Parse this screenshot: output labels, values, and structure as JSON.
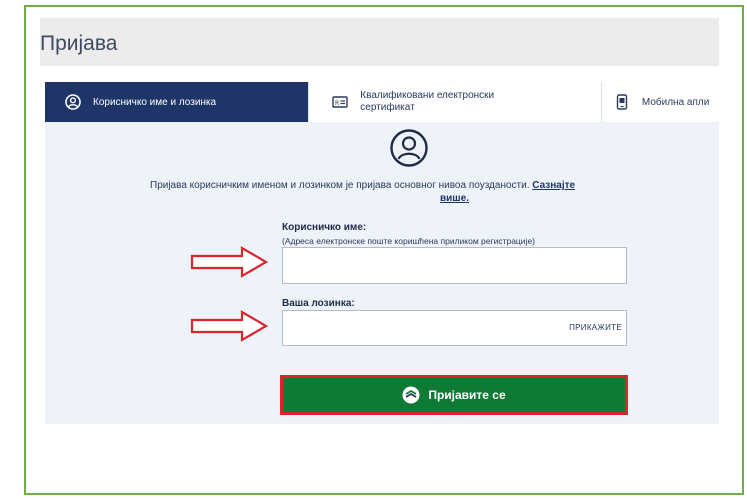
{
  "page": {
    "title": "Пријава"
  },
  "tabs": [
    {
      "label": "Корисничко име и лозинка",
      "icon": "user-circle-icon",
      "active": true
    },
    {
      "label_line1": "Квалификовани електронски",
      "label_line2": "сертификат",
      "icon": "id-card-icon"
    },
    {
      "label": "Мобилна апли",
      "icon": "mobile-phone-icon"
    }
  ],
  "info": {
    "text": "Пријава корисничким именом и лозинком је пријава основног нивоа поузданости. ",
    "more_part1": "Сазнајте",
    "more_part2": "више."
  },
  "form": {
    "username_label": "Корисничко име:",
    "username_hint": "(Адреса електронске поште коришћена приликом регистрације)",
    "username_value": "",
    "password_label": "Ваша лозинка:",
    "password_value": "",
    "show_password_label": "ПРИКАЖИТЕ",
    "submit_label": "Пријавите се"
  },
  "colors": {
    "active_tab": "#1f3568",
    "submit_button": "#0e7a35",
    "annotation_red": "#d9262b",
    "frame_green": "#6dae45"
  }
}
